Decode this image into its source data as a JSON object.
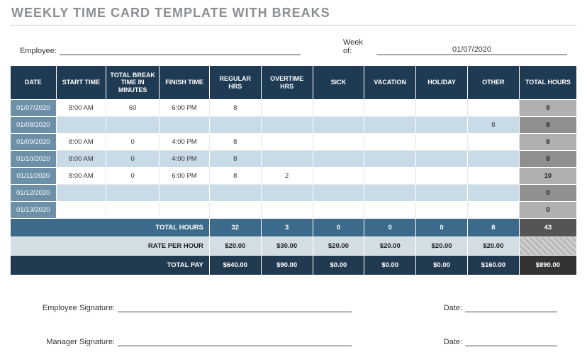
{
  "title": "WEEKLY TIME CARD TEMPLATE WITH BREAKS",
  "meta": {
    "employee_label": "Employee:",
    "employee_value": "",
    "weekof_label": "Week of:",
    "weekof_value": "01/07/2020"
  },
  "headers": {
    "date": "DATE",
    "start": "START TIME",
    "break": "TOTAL BREAK TIME IN MINUTES",
    "finish": "FINISH TIME",
    "regular": "REGULAR HRS",
    "overtime": "OVERTIME HRS",
    "sick": "SICK",
    "vacation": "VACATION",
    "holiday": "HOLIDAY",
    "other": "OTHER",
    "total": "TOTAL HOURS"
  },
  "rows": [
    {
      "date": "01/07/2020",
      "start": "8:00 AM",
      "break": "60",
      "finish": "6:00 PM",
      "regular": "8",
      "overtime": "",
      "sick": "",
      "vacation": "",
      "holiday": "",
      "other": "",
      "total": "9"
    },
    {
      "date": "01/08/2020",
      "start": "",
      "break": "",
      "finish": "",
      "regular": "",
      "overtime": "",
      "sick": "",
      "vacation": "",
      "holiday": "",
      "other": "8",
      "total": "8"
    },
    {
      "date": "01/09/2020",
      "start": "8:00 AM",
      "break": "0",
      "finish": "4:00 PM",
      "regular": "8",
      "overtime": "",
      "sick": "",
      "vacation": "",
      "holiday": "",
      "other": "",
      "total": "8"
    },
    {
      "date": "01/10/2020",
      "start": "8:00 AM",
      "break": "0",
      "finish": "4:00 PM",
      "regular": "8",
      "overtime": "",
      "sick": "",
      "vacation": "",
      "holiday": "",
      "other": "",
      "total": "8"
    },
    {
      "date": "01/11/2020",
      "start": "8:00 AM",
      "break": "0",
      "finish": "6:00 PM",
      "regular": "8",
      "overtime": "2",
      "sick": "",
      "vacation": "",
      "holiday": "",
      "other": "",
      "total": "10"
    },
    {
      "date": "01/12/2020",
      "start": "",
      "break": "",
      "finish": "",
      "regular": "",
      "overtime": "",
      "sick": "",
      "vacation": "",
      "holiday": "",
      "other": "",
      "total": "0"
    },
    {
      "date": "01/13/2020",
      "start": "",
      "break": "",
      "finish": "",
      "regular": "",
      "overtime": "",
      "sick": "",
      "vacation": "",
      "holiday": "",
      "other": "",
      "total": "0"
    }
  ],
  "summary": {
    "total_hours_label": "TOTAL HOURS",
    "rate_label": "RATE PER HOUR",
    "total_pay_label": "TOTAL PAY",
    "hours": {
      "regular": "32",
      "overtime": "3",
      "sick": "0",
      "vacation": "0",
      "holiday": "0",
      "other": "8",
      "grand": "43"
    },
    "rate": {
      "regular": "$20.00",
      "overtime": "$30.00",
      "sick": "$20.00",
      "vacation": "$20.00",
      "holiday": "$20.00",
      "other": "$20.00"
    },
    "pay": {
      "regular": "$640.00",
      "overtime": "$90.00",
      "sick": "$0.00",
      "vacation": "$0.00",
      "holiday": "$0.00",
      "other": "$160.00",
      "grand": "$890.00"
    }
  },
  "signatures": {
    "emp_label": "Employee Signature:",
    "mgr_label": "Manager Signature:",
    "date_label": "Date:"
  },
  "chart_data": {
    "type": "table",
    "title": "Weekly Time Card Template With Breaks",
    "week_of": "01/07/2020",
    "columns": [
      "DATE",
      "START TIME",
      "TOTAL BREAK TIME IN MINUTES",
      "FINISH TIME",
      "REGULAR HRS",
      "OVERTIME HRS",
      "SICK",
      "VACATION",
      "HOLIDAY",
      "OTHER",
      "TOTAL HOURS"
    ],
    "rows": [
      [
        "01/07/2020",
        "8:00 AM",
        60,
        "6:00 PM",
        8,
        null,
        null,
        null,
        null,
        null,
        9
      ],
      [
        "01/08/2020",
        null,
        null,
        null,
        null,
        null,
        null,
        null,
        null,
        8,
        8
      ],
      [
        "01/09/2020",
        "8:00 AM",
        0,
        "4:00 PM",
        8,
        null,
        null,
        null,
        null,
        null,
        8
      ],
      [
        "01/10/2020",
        "8:00 AM",
        0,
        "4:00 PM",
        8,
        null,
        null,
        null,
        null,
        null,
        8
      ],
      [
        "01/11/2020",
        "8:00 AM",
        0,
        "6:00 PM",
        8,
        2,
        null,
        null,
        null,
        null,
        10
      ],
      [
        "01/12/2020",
        null,
        null,
        null,
        null,
        null,
        null,
        null,
        null,
        null,
        0
      ],
      [
        "01/13/2020",
        null,
        null,
        null,
        null,
        null,
        null,
        null,
        null,
        null,
        0
      ]
    ],
    "totals": {
      "regular_hrs": 32,
      "overtime_hrs": 3,
      "sick": 0,
      "vacation": 0,
      "holiday": 0,
      "other": 8,
      "total_hours": 43
    },
    "rate_per_hour": {
      "regular": 20.0,
      "overtime": 30.0,
      "sick": 20.0,
      "vacation": 20.0,
      "holiday": 20.0,
      "other": 20.0
    },
    "total_pay": {
      "regular": 640.0,
      "overtime": 90.0,
      "sick": 0.0,
      "vacation": 0.0,
      "holiday": 0.0,
      "other": 160.0,
      "grand_total": 890.0
    }
  }
}
